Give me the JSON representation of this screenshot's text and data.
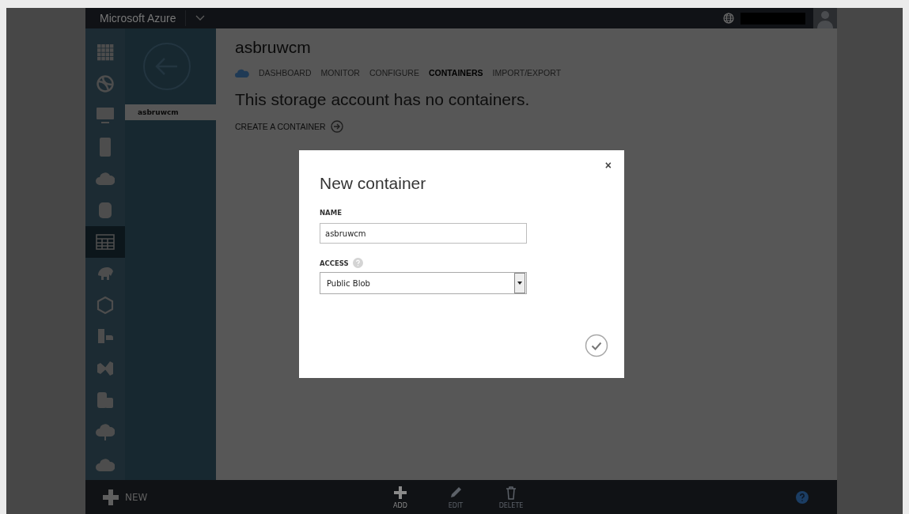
{
  "top_bar": {
    "title": "Microsoft Azure"
  },
  "sidebar": {
    "items": [
      {
        "selected": false
      },
      {
        "selected": false
      },
      {
        "selected": false
      },
      {
        "selected": false
      },
      {
        "selected": false
      },
      {
        "selected": false
      },
      {
        "selected": true
      },
      {
        "selected": false
      },
      {
        "selected": false
      },
      {
        "selected": false
      },
      {
        "selected": false
      },
      {
        "selected": false
      },
      {
        "selected": false
      },
      {
        "selected": false
      }
    ]
  },
  "nav_panel": {
    "items": [
      {
        "label": "asbruwcm",
        "selected": true
      }
    ]
  },
  "content": {
    "title": "asbruwcm",
    "tabs": [
      {
        "label": "DASHBOARD",
        "selected": false
      },
      {
        "label": "MONITOR",
        "selected": false
      },
      {
        "label": "CONFIGURE",
        "selected": false
      },
      {
        "label": "CONTAINERS",
        "selected": true
      },
      {
        "label": "IMPORT/EXPORT",
        "selected": false
      }
    ],
    "message": "This storage account has no containers.",
    "create_link": "CREATE A CONTAINER"
  },
  "dialog": {
    "title": "New container",
    "close": "×",
    "name_label": "NAME",
    "name_value": "asbruwcm",
    "access_label": "ACCESS",
    "access_value": "Public Blob"
  },
  "bottom_bar": {
    "new_label": "NEW",
    "actions": [
      {
        "label": "ADD",
        "disabled": false
      },
      {
        "label": "EDIT",
        "disabled": true
      },
      {
        "label": "DELETE",
        "disabled": true
      }
    ]
  }
}
